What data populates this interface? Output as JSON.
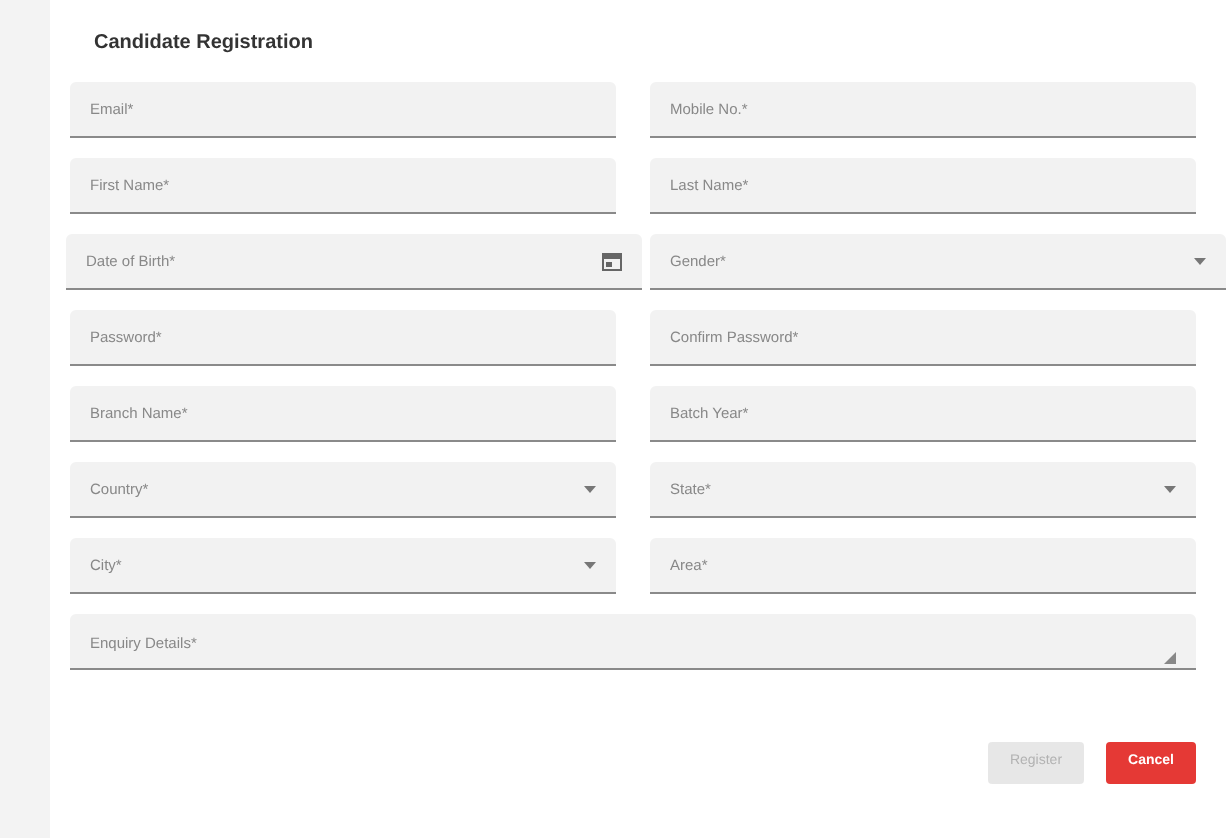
{
  "title": "Candidate Registration",
  "rows": [
    [
      {
        "kind": "text",
        "placeholder": "Email*"
      },
      {
        "kind": "text",
        "placeholder": "Mobile No.*"
      }
    ],
    [
      {
        "kind": "text",
        "placeholder": "First Name*"
      },
      {
        "kind": "text",
        "placeholder": "Last Name*"
      }
    ],
    [
      {
        "kind": "date",
        "placeholder": "Date of Birth*"
      },
      {
        "kind": "select",
        "placeholder": "Gender*"
      }
    ],
    [
      {
        "kind": "text",
        "placeholder": "Password*"
      },
      {
        "kind": "text",
        "placeholder": "Confirm Password*"
      }
    ],
    [
      {
        "kind": "text",
        "placeholder": "Branch Name*"
      },
      {
        "kind": "text",
        "placeholder": "Batch Year*"
      }
    ],
    [
      {
        "kind": "select",
        "placeholder": "Country*"
      },
      {
        "kind": "select",
        "placeholder": "State*"
      }
    ],
    [
      {
        "kind": "select",
        "placeholder": "City*"
      },
      {
        "kind": "text",
        "placeholder": "Area*"
      }
    ],
    [
      {
        "kind": "textarea",
        "placeholder": "Enquiry Details*"
      }
    ]
  ],
  "buttons": [
    {
      "label": "Register",
      "kind": "secondary",
      "disabled": true
    },
    {
      "label": "Cancel",
      "kind": "danger",
      "disabled": false
    }
  ]
}
